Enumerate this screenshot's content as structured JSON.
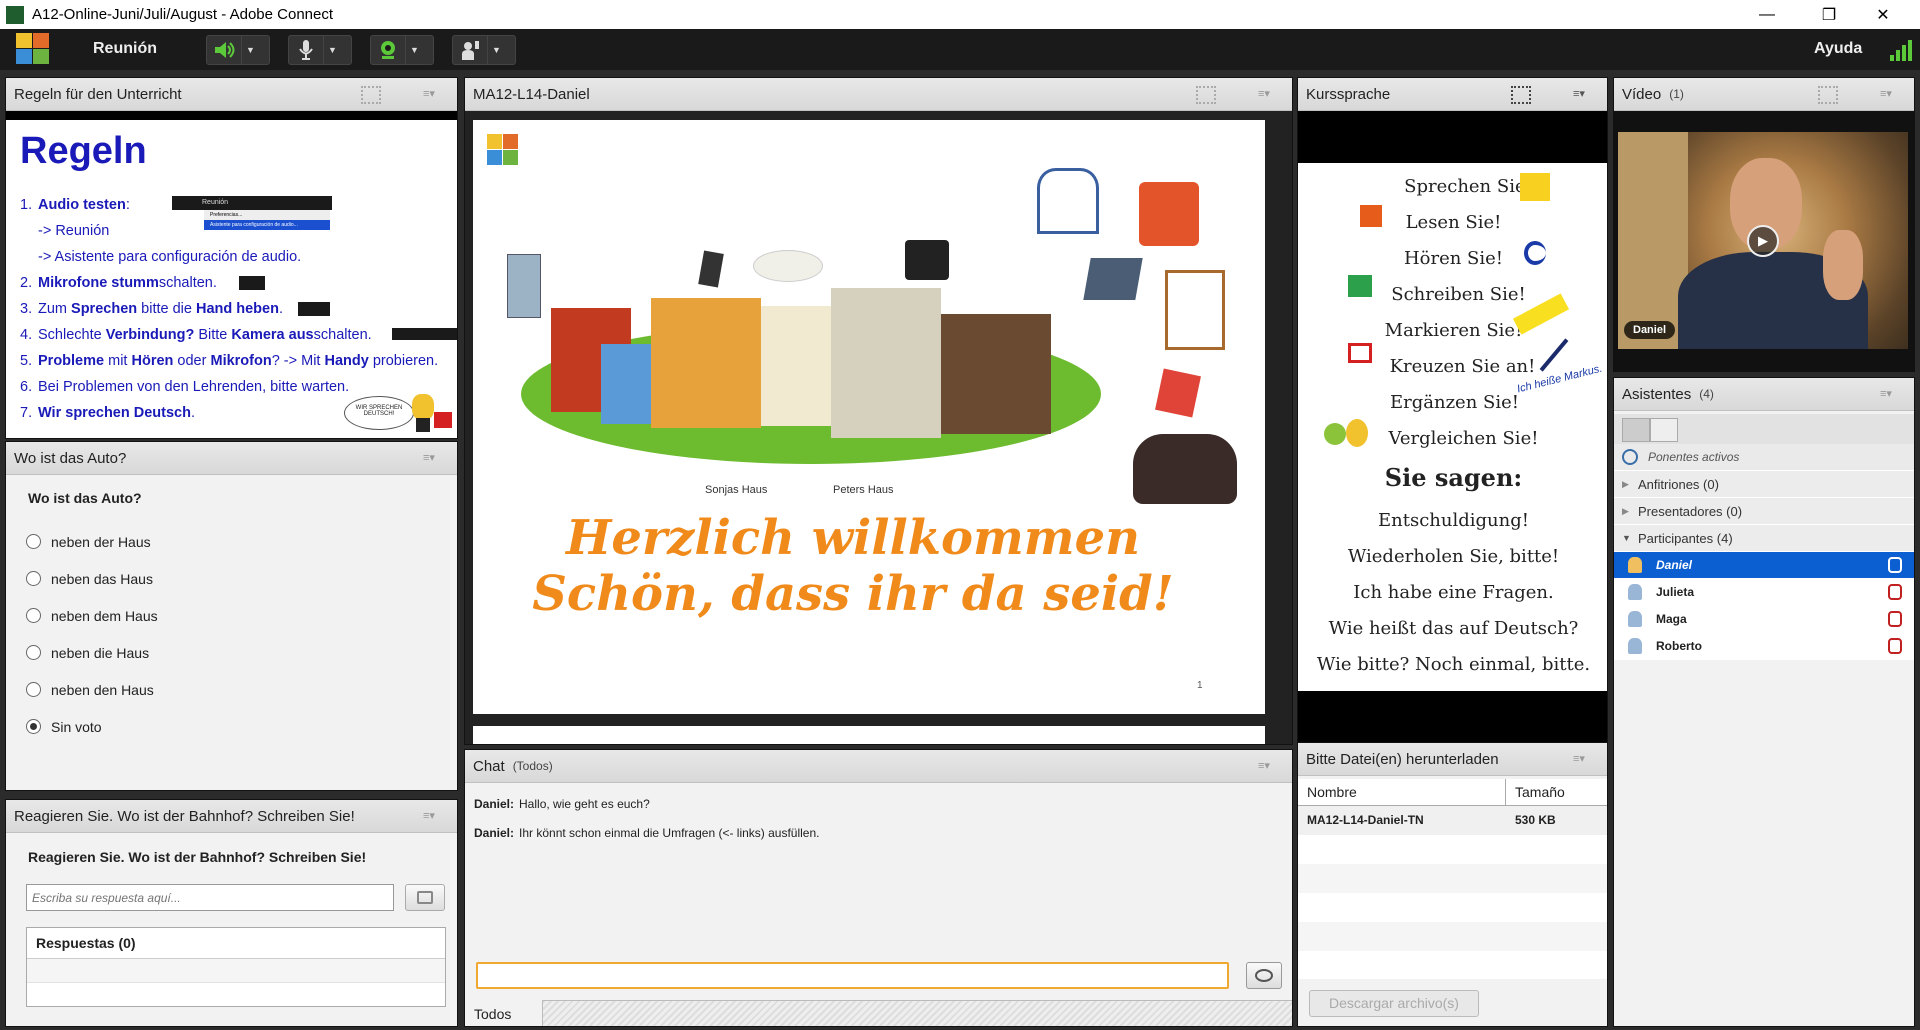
{
  "window": {
    "title": "A12-Online-Juni/Juli/August - Adobe Connect"
  },
  "menubar": {
    "meeting": "Reunión",
    "help": "Ayuda"
  },
  "rules_pod": {
    "title": "Regeln für den Unterricht",
    "heading": "Regeln",
    "items": [
      {
        "num": "1.",
        "a": "Audio testen",
        "b": ":"
      },
      {
        "num": "",
        "a": "",
        "b": "-> Reunión"
      },
      {
        "num": "",
        "a": "",
        "b": "-> Asistente para configuración de audio."
      },
      {
        "num": "2.",
        "a": "Mikrofone stumm",
        "b": "schalten."
      },
      {
        "num": "3.",
        "a": "Zum Sprechen bitte die Hand heben.",
        "b": ""
      },
      {
        "num": "4.",
        "a": "Schlechte Verbindung? Bitte Kamera ausschalten.",
        "b": ""
      },
      {
        "num": "5.",
        "a": "Probleme mit Hören oder Mikrofon? -> Mit Handy probieren.",
        "b": ""
      },
      {
        "num": "6.",
        "a": "",
        "b": "Bei Problemen von den Lehrenden, bitte warten."
      },
      {
        "num": "7.",
        "a": "Wir sprechen Deutsch.",
        "b": ""
      }
    ],
    "menu_mock": {
      "top": "Reunión",
      "item1": "Preferencias...",
      "item2": "Asistente para configuración de audio..."
    },
    "badge": "WIR SPRECHEN DEUTSCH!"
  },
  "poll_pod": {
    "title": "Wo ist das Auto?",
    "question": "Wo ist das Auto?",
    "options": [
      "neben der Haus",
      "neben das Haus",
      "neben dem Haus",
      "neben die Haus",
      "neben den Haus",
      "Sin voto"
    ],
    "selected": 5
  },
  "qa_pod": {
    "title": "Reagieren Sie. Wo ist der Bahnhof? Schreiben Sie!",
    "question": "Reagieren Sie. Wo ist der Bahnhof? Schreiben Sie!",
    "placeholder": "Escriba su respuesta aquí...",
    "answers_label": "Respuestas (0)"
  },
  "share_pod": {
    "title": "MA12-L14-Daniel",
    "slide": {
      "house1": "Sonjas Haus",
      "house2": "Peters Haus",
      "line1": "Herzlich willkommen",
      "line2": "Schön, dass ihr da seid!",
      "page": "1"
    }
  },
  "chat_pod": {
    "title": "Chat",
    "scope": "(Todos)",
    "messages": [
      {
        "from": "Daniel:",
        "text": "Hallo, wie geht es euch?"
      },
      {
        "from": "Daniel:",
        "text": "Ihr könnt schon einmal die Umfragen (<- links) ausfüllen."
      }
    ],
    "input_value": "",
    "tab": "Todos"
  },
  "kurs_pod": {
    "title": "Kurssprache",
    "lines": [
      "Sprechen Sie!",
      "Lesen Sie!",
      "Hören Sie!",
      "Schreiben Sie!",
      "Markieren Sie!",
      "Kreuzen Sie an!",
      "Ergänzen Sie!",
      "Vergleichen Sie!"
    ],
    "say_title": "Sie sagen:",
    "say_lines": [
      "Entschuldigung!",
      "Wiederholen Sie, bitte!",
      "Ich habe eine Fragen.",
      "Wie heißt das auf Deutsch?",
      "Wie bitte? Noch einmal, bitte."
    ],
    "note": "Ich heiße Markus."
  },
  "files_pod": {
    "title": "Bitte Datei(en) herunterladen",
    "col_name": "Nombre",
    "col_size": "Tamaño",
    "rows": [
      {
        "name": "MA12-L14-Daniel-TN",
        "size": "530 KB"
      }
    ],
    "download": "Descargar archivo(s)"
  },
  "video_pod": {
    "title": "Vídeo",
    "count": "(1)",
    "name": "Daniel"
  },
  "attendees_pod": {
    "title": "Asistentes",
    "count": "(4)",
    "active": "Ponentes activos",
    "hosts": "Anfitriones (0)",
    "presenters": "Presentadores (0)",
    "participants": "Participantes (4)",
    "people": [
      "Daniel",
      "Julieta",
      "Maga",
      "Roberto"
    ]
  },
  "colors": {
    "accent": "#0066cc",
    "slide_orange": "#f08a1a",
    "rules_blue": "#1a1ab8"
  }
}
